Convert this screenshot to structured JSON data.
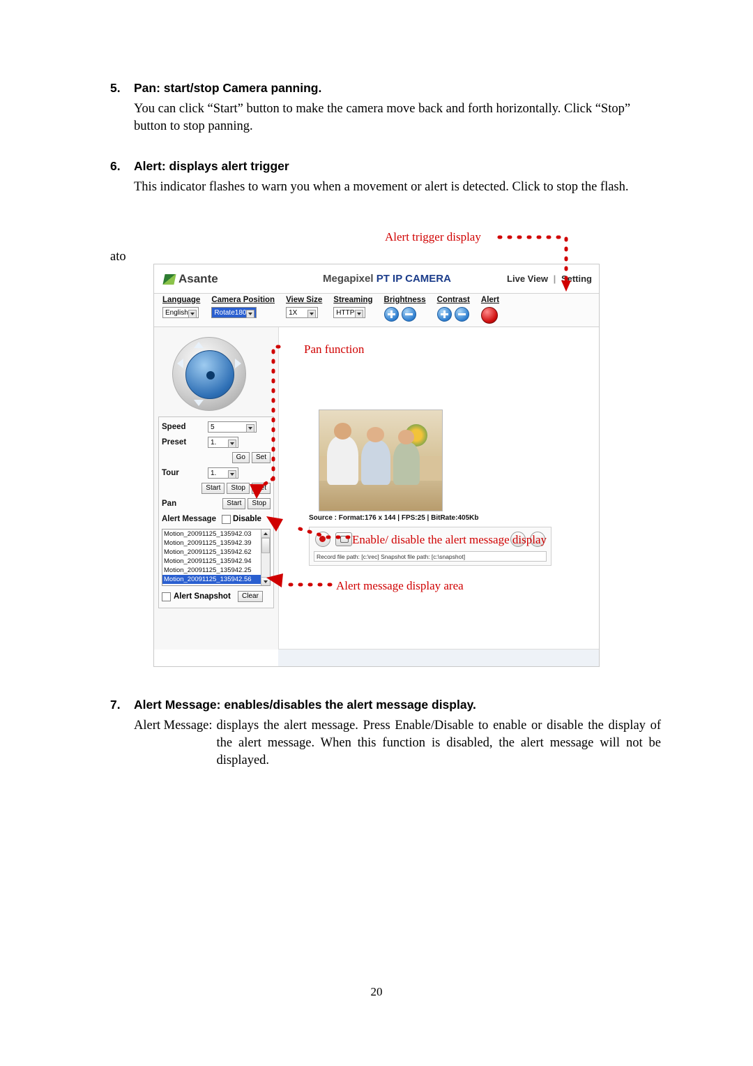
{
  "document": {
    "page_number": "20",
    "stray_text": "ato",
    "sections": [
      {
        "number": "5.",
        "heading": "Pan: start/stop Camera panning.",
        "body": "You can click “Start” button to make the camera move back and forth horizontally. Click “Stop” button to stop panning."
      },
      {
        "number": "6.",
        "heading": "Alert: displays alert trigger",
        "body": "This indicator flashes to warn you when a movement or alert is detected. Click to stop the flash."
      },
      {
        "number": "7.",
        "heading": "Alert Message: enables/disables the alert message display.",
        "body_label": "Alert Message:",
        "body_text": "displays the alert message. Press Enable/Disable to enable or disable the display of the alert message. When this function is disabled, the alert message will not be displayed."
      }
    ]
  },
  "annotations": {
    "alert_trigger": "Alert trigger display",
    "pan_function": "Pan function",
    "enable_disable": "Enable/ disable the alert message display",
    "message_area": "Alert message display area",
    "color": "#d00000"
  },
  "screenshot": {
    "header": {
      "brand": "Asante",
      "title_blue": "Megapixel PT IP CAMERA",
      "title_grey": "Megapixel",
      "nav_live_view": "Live View",
      "nav_separator": "|",
      "nav_setting": "Setting"
    },
    "toolbar": [
      {
        "label": "Language",
        "value": "English",
        "type": "select"
      },
      {
        "label": "Camera Position",
        "value": "Rotate180",
        "type": "select-highlight"
      },
      {
        "label": "View Size",
        "value": "1X",
        "type": "select"
      },
      {
        "label": "Streaming",
        "value": "HTTP",
        "type": "select"
      },
      {
        "label": "Brightness",
        "value": "",
        "type": "plusminus"
      },
      {
        "label": "Contrast",
        "value": "",
        "type": "plusminus"
      },
      {
        "label": "Alert",
        "value": "",
        "type": "led"
      }
    ],
    "controls": {
      "speed_label": "Speed",
      "speed_value": "5",
      "preset_label": "Preset",
      "preset_value": "1.",
      "preset_go": "Go",
      "preset_set": "Set",
      "tour_label": "Tour",
      "tour_value": "1.",
      "tour_start": "Start",
      "tour_stop": "Stop",
      "tour_set": "Set",
      "pan_label": "Pan",
      "pan_start": "Start",
      "pan_stop": "Stop",
      "alert_message_label": "Alert Message",
      "alert_message_disable": "Disable",
      "alert_snapshot_label": "Alert Snapshot",
      "alert_snapshot_clear": "Clear"
    },
    "alert_messages": [
      "Motion_20091125_135942.03",
      "Motion_20091125_135942.39",
      "Motion_20091125_135942.62",
      "Motion_20091125_135942.94",
      "Motion_20091125_135942.25",
      "Motion_20091125_135942.56"
    ],
    "alert_messages_selected_index": 5,
    "video": {
      "source_prefix": "Source :",
      "source_format": "Format:176 x 144",
      "source_fps": "FPS:25",
      "source_bitrate": "BitRate:405Kb",
      "source_line": "Source : Format:176 x 144 | FPS:25 | BitRate:405Kb"
    },
    "player": {
      "record_path_label": "Record file path: [c:\\rec]",
      "snapshot_path_label": "Snapshot file path: [c:\\snapshot]",
      "path_line": "Record file path: [c:\\rec]  Snapshot file path: [c:\\snapshot]",
      "icons": [
        "record-icon",
        "snapshot-icon",
        "speaker-icon",
        "mic-icon"
      ]
    }
  }
}
